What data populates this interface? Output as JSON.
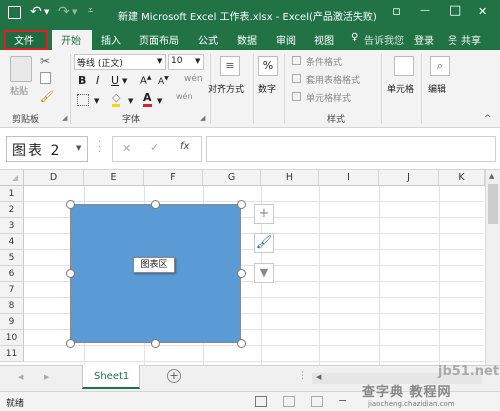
{
  "titlebar": {
    "title": "新建 Microsoft Excel 工作表.xlsx - Excel(产品激活失败)",
    "restore_icon": "▫",
    "minimize_icon": "—",
    "maximize_icon": "□",
    "close_icon": "✕"
  },
  "tabs": {
    "file": "文件",
    "home": "开始",
    "insert": "插入",
    "page_layout": "页面布局",
    "formulas": "公式",
    "data": "数据",
    "review": "审阅",
    "view": "视图",
    "tell_me": "告诉我您",
    "login": "登录",
    "share": "共享"
  },
  "ribbon": {
    "clipboard_label": "剪贴板",
    "paste": "粘贴",
    "font_name": "等线 (正文)",
    "font_size": "10",
    "bold": "B",
    "italic": "I",
    "underline": "U",
    "font_label": "字体",
    "alignment": "对齐方式",
    "number": "数字",
    "percent": "%",
    "conditional_format": "条件格式",
    "format_as_table": "套用表格格式",
    "cell_styles": "单元格样式",
    "styles_label": "样式",
    "cells": "单元格",
    "editing": "编辑"
  },
  "formulabar": {
    "name_box": "图表 2",
    "fx": "fx",
    "cancel": "✕",
    "enter": "✓"
  },
  "grid": {
    "columns": [
      "D",
      "E",
      "F",
      "G",
      "H",
      "I",
      "J",
      "K"
    ],
    "rows": [
      "1",
      "2",
      "3",
      "4",
      "5",
      "6",
      "7",
      "8",
      "9",
      "10",
      "11"
    ]
  },
  "chart": {
    "label": "图表区",
    "fill_color": "#5b9bd5"
  },
  "sheets": {
    "active": "Sheet1",
    "add": "+"
  },
  "status": {
    "ready": "就绪"
  },
  "watermark": {
    "line1": "jb51.net",
    "line2": "查字典 教程网",
    "line3": "jiaocheng.chazidian.com"
  },
  "colors": {
    "excel_green": "#217346",
    "file_highlight": "#e02020"
  }
}
